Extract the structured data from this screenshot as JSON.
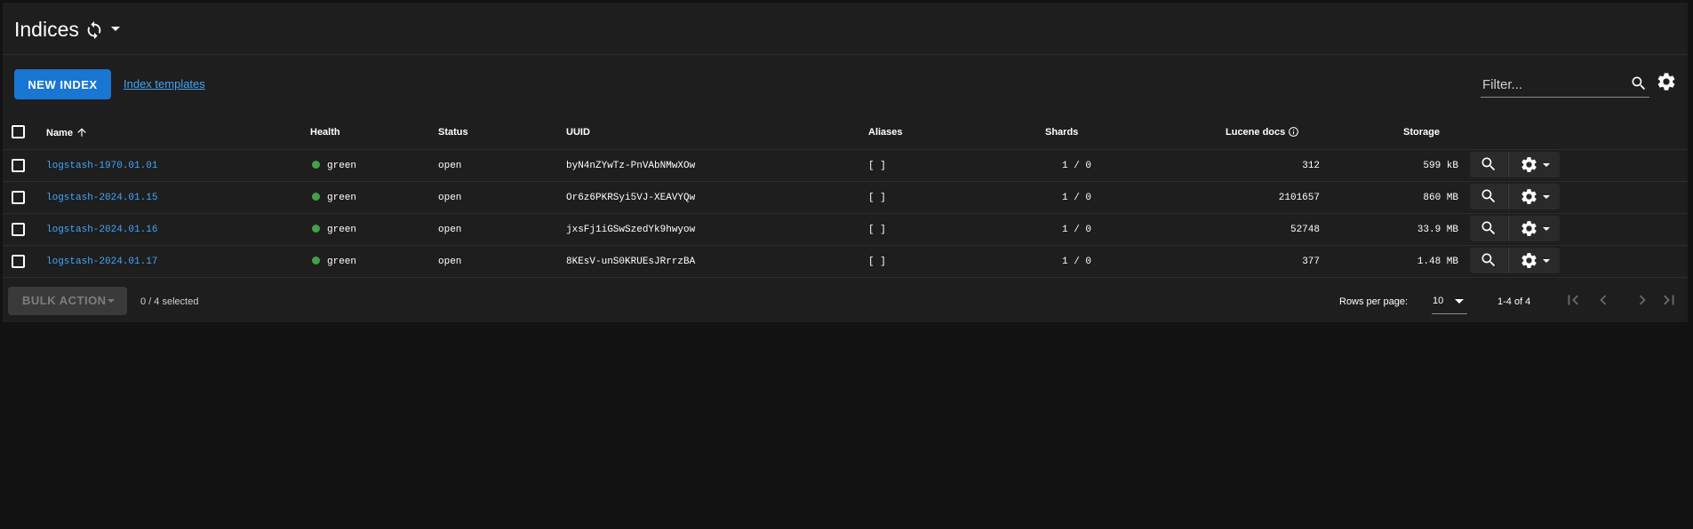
{
  "header": {
    "title": "Indices",
    "refresh_icon": "refresh-icon",
    "refresh_menu_icon": "caret-down-icon"
  },
  "toolbar": {
    "new_index_label": "NEW INDEX",
    "index_templates_label": "Index templates",
    "filter_placeholder": "Filter...",
    "filter_value": "",
    "filter_icon": "search-icon",
    "columns_settings_icon": "gear-icon"
  },
  "table": {
    "columns": {
      "name": "Name",
      "health": "Health",
      "status": "Status",
      "uuid": "UUID",
      "aliases": "Aliases",
      "shards": "Shards",
      "lucene_docs": "Lucene docs",
      "storage": "Storage"
    },
    "sort": {
      "column": "Name",
      "direction": "ascending",
      "icon": "arrow-up-icon"
    },
    "rows": [
      {
        "name": "logstash-1970.01.01",
        "health": "green",
        "status": "open",
        "uuid": "byN4nZYwTz-PnVAbNMwXOw",
        "aliases": "[ ]",
        "shards": "1 / 0",
        "lucene_docs": "312",
        "storage": "599 kB"
      },
      {
        "name": "logstash-2024.01.15",
        "health": "green",
        "status": "open",
        "uuid": "Or6z6PKRSyi5VJ-XEAVYQw",
        "aliases": "[ ]",
        "shards": "1 / 0",
        "lucene_docs": "2101657",
        "storage": "860 MB"
      },
      {
        "name": "logstash-2024.01.16",
        "health": "green",
        "status": "open",
        "uuid": "jxsFj1iGSwSzedYk9hwyow",
        "aliases": "[ ]",
        "shards": "1 / 0",
        "lucene_docs": "52748",
        "storage": "33.9 MB"
      },
      {
        "name": "logstash-2024.01.17",
        "health": "green",
        "status": "open",
        "uuid": "8KEsV-unS0KRUEsJRrrzBA",
        "aliases": "[ ]",
        "shards": "1 / 0",
        "lucene_docs": "377",
        "storage": "1.48 MB"
      }
    ]
  },
  "footer": {
    "bulk_action_label": "BULK ACTION",
    "selected_text": "0 / 4 selected",
    "rows_per_page_label": "Rows per page:",
    "rows_per_page_value": "10",
    "range_text": "1-4 of 4"
  },
  "colors": {
    "background": "#121212",
    "panel": "#1e1e1e",
    "accent": "#1976d2",
    "link": "#42a5f5",
    "health_green": "#43a047"
  }
}
